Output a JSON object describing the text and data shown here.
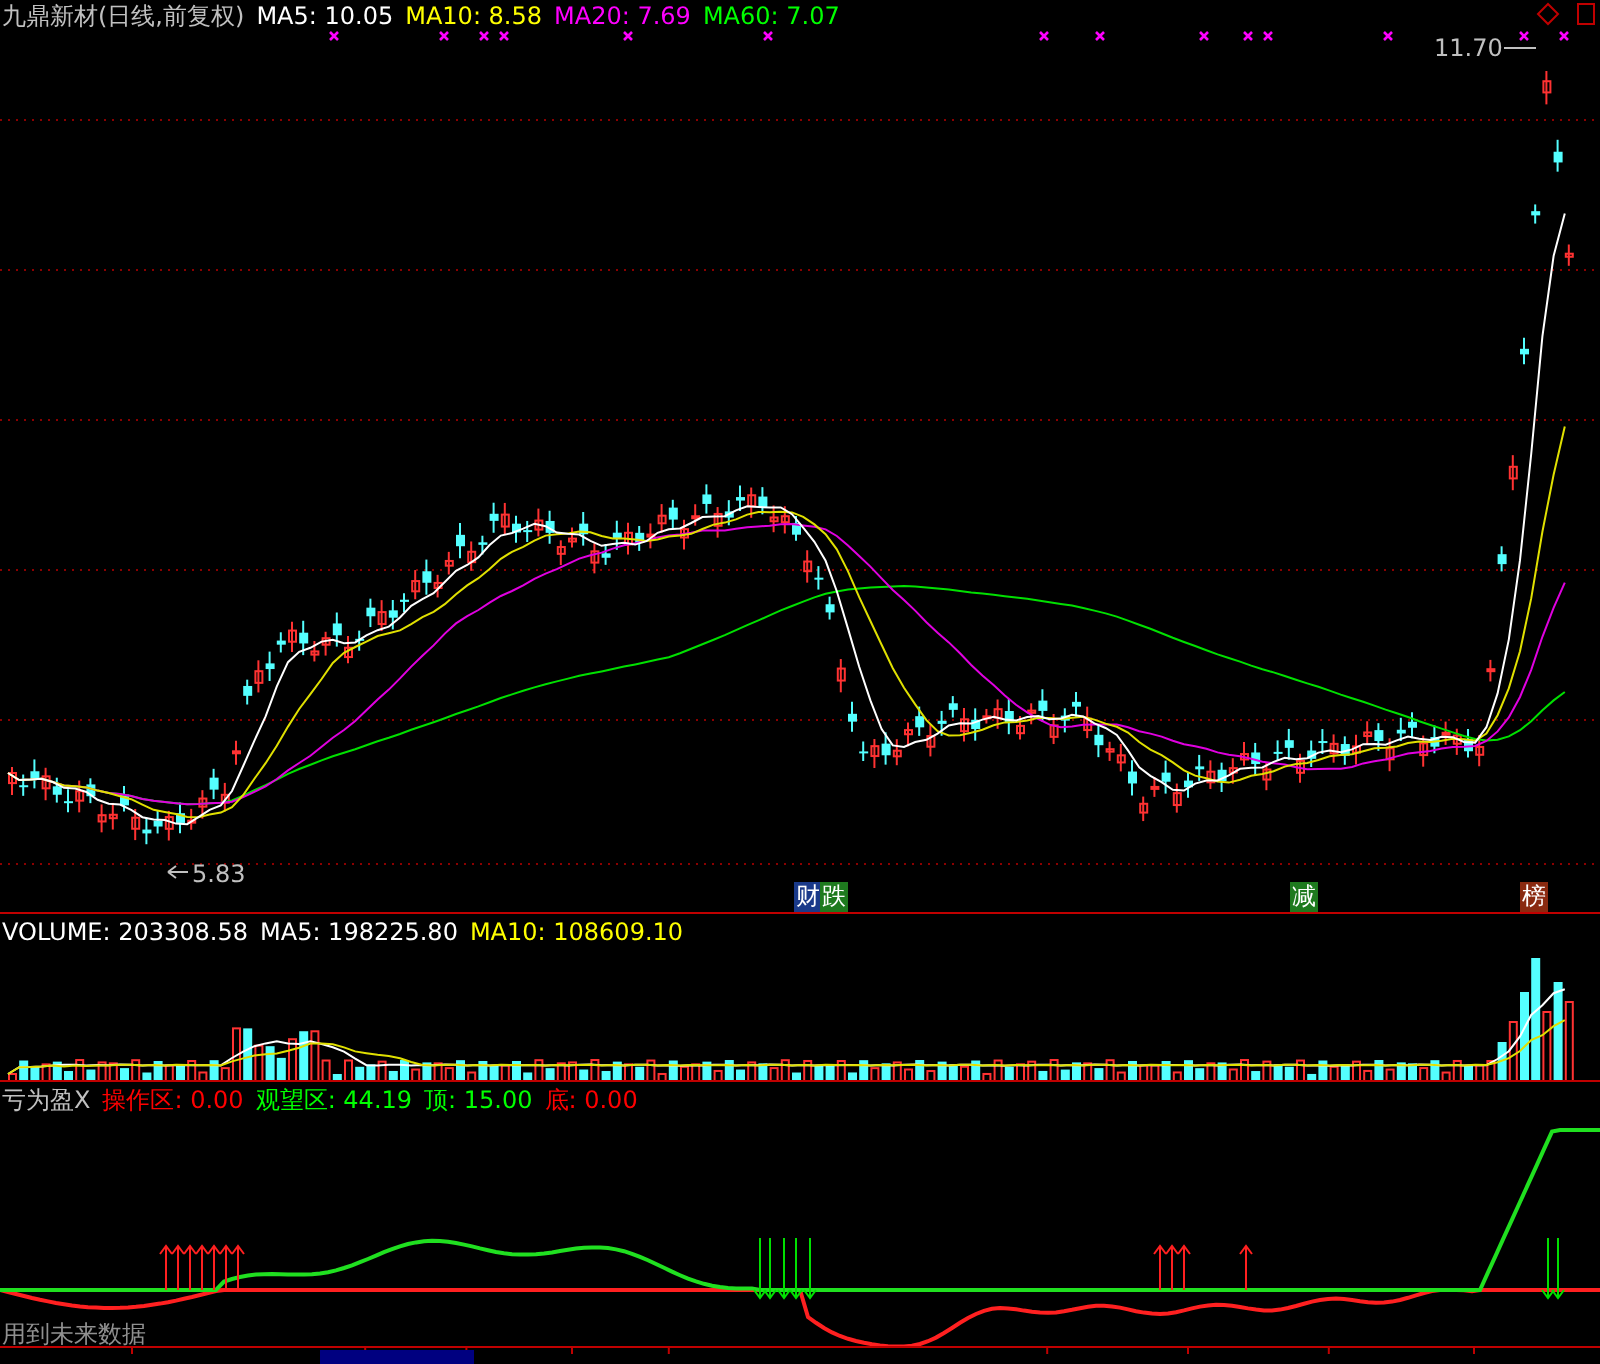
{
  "price_panel": {
    "title": "九鼎新材(日线,前复权)",
    "legend": [
      {
        "label": "MA5: 10.05",
        "color": "#ffffff"
      },
      {
        "label": "MA10: 8.58",
        "color": "#ffff00"
      },
      {
        "label": "MA20: 7.69",
        "color": "#ff00ff"
      },
      {
        "label": "MA60: 7.07",
        "color": "#00ff00"
      }
    ],
    "high_label": "11.70",
    "low_label": "5.83",
    "tags": [
      {
        "label": "财",
        "color": "#1a3a8a"
      },
      {
        "label": "跌",
        "color": "#1e7a1e"
      },
      {
        "label": "减",
        "color": "#1e7a1e"
      },
      {
        "label": "榜",
        "color": "#8a2a10"
      }
    ]
  },
  "volume_panel": {
    "legend": [
      {
        "label": "VOLUME: 203308.58",
        "color": "#ffffff"
      },
      {
        "label": "MA5: 198225.80",
        "color": "#ffffff"
      },
      {
        "label": "MA10: 108609.10",
        "color": "#ffff00"
      }
    ]
  },
  "indicator_panel": {
    "legend": [
      {
        "label": "亏为盈X",
        "color": "#c0c0c0"
      },
      {
        "label": "操作区: 0.00",
        "color": "#ff0000"
      },
      {
        "label": "观望区: 44.19",
        "color": "#00ff00"
      },
      {
        "label": "顶: 15.00",
        "color": "#00ff00"
      },
      {
        "label": "底: 0.00",
        "color": "#ff0000"
      }
    ],
    "note": "用到未来数据"
  }
}
